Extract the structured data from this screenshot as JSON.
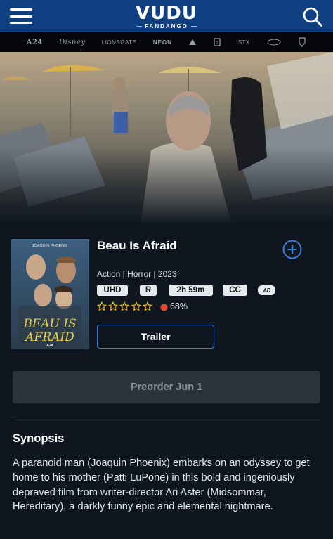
{
  "header": {
    "logo_text": "VUDU",
    "logo_subtext": "FANDANGO",
    "menu_icon": "hamburger-menu-icon",
    "search_icon": "search-icon"
  },
  "studios": [
    "A24",
    "Disney",
    "LIONSGATE",
    "NEON",
    "Paramount",
    "Warner Bros",
    "STX",
    "Universal",
    "Warner Bros"
  ],
  "movie": {
    "title": "Beau Is Afraid",
    "meta": "Action | Horror | 2023",
    "badges": [
      "UHD",
      "R",
      "2h 59m",
      "CC",
      "AD"
    ],
    "stars_filled": 0,
    "stars_total": 5,
    "tomatometer": "68%",
    "trailer_label": "Trailer",
    "add_icon": "add-to-list-icon",
    "poster": {
      "top_credit": "JOAQUIN PHOENIX",
      "title_line1": "BEAU IS",
      "title_line2": "AFRAID",
      "studio": "A24"
    }
  },
  "preorder_label": "Preorder Jun 1",
  "synopsis": {
    "heading": "Synopsis",
    "text": "A paranoid man (Joaquin Phoenix) embarks on an odyssey to get home to his mother (Patti LuPone) in this bold and ingeniously depraved film from writer-director Ari Aster (Midsommar, Hereditary), a darkly funny epic and elemental nightmare."
  },
  "colors": {
    "header_bg": "#0f3f80",
    "page_bg": "#0f1620",
    "accent_blue": "#3f7fd3",
    "star_yellow": "#f5c518",
    "tomato_red": "#e8432e"
  }
}
